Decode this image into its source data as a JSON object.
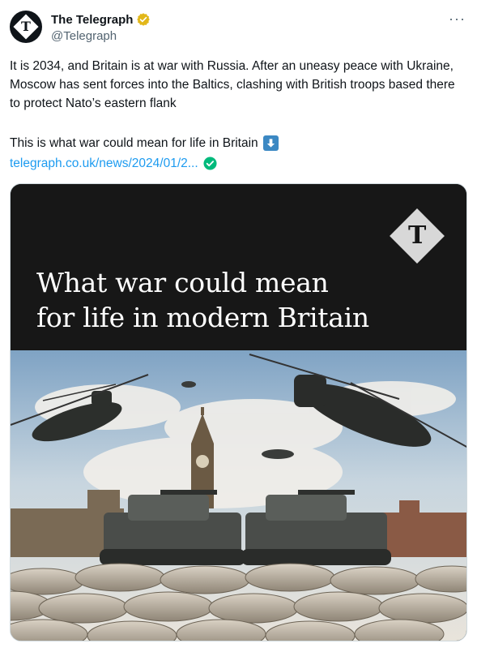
{
  "tweet": {
    "display_name": "The Telegraph",
    "handle": "@Telegraph",
    "avatar_letter": "T",
    "more_label": "···",
    "body_paragraph_1": "It is 2034, and Britain is at war with Russia. After an uneasy peace with Ukraine, Moscow has sent forces into the Baltics, clashing with British troops based there to protect Nato’s eastern flank",
    "body_paragraph_2": "This is what war could mean for life in Britain",
    "link_text": "telegraph.co.uk/news/2024/01/2...",
    "icons": {
      "verified": "gold-verified-badge-icon",
      "arrow": "down-arrow-emoji-icon",
      "link_check": "green-check-icon",
      "more": "more-options-icon"
    },
    "colors": {
      "link": "#1d9bf0",
      "verified_gold": "#e2b719",
      "check_green": "#00ba7c",
      "handle_gray": "#536471"
    }
  },
  "media": {
    "logo_letter": "T",
    "headline_line_1": "What war could mean",
    "headline_line_2": "for life in modern Britain"
  }
}
